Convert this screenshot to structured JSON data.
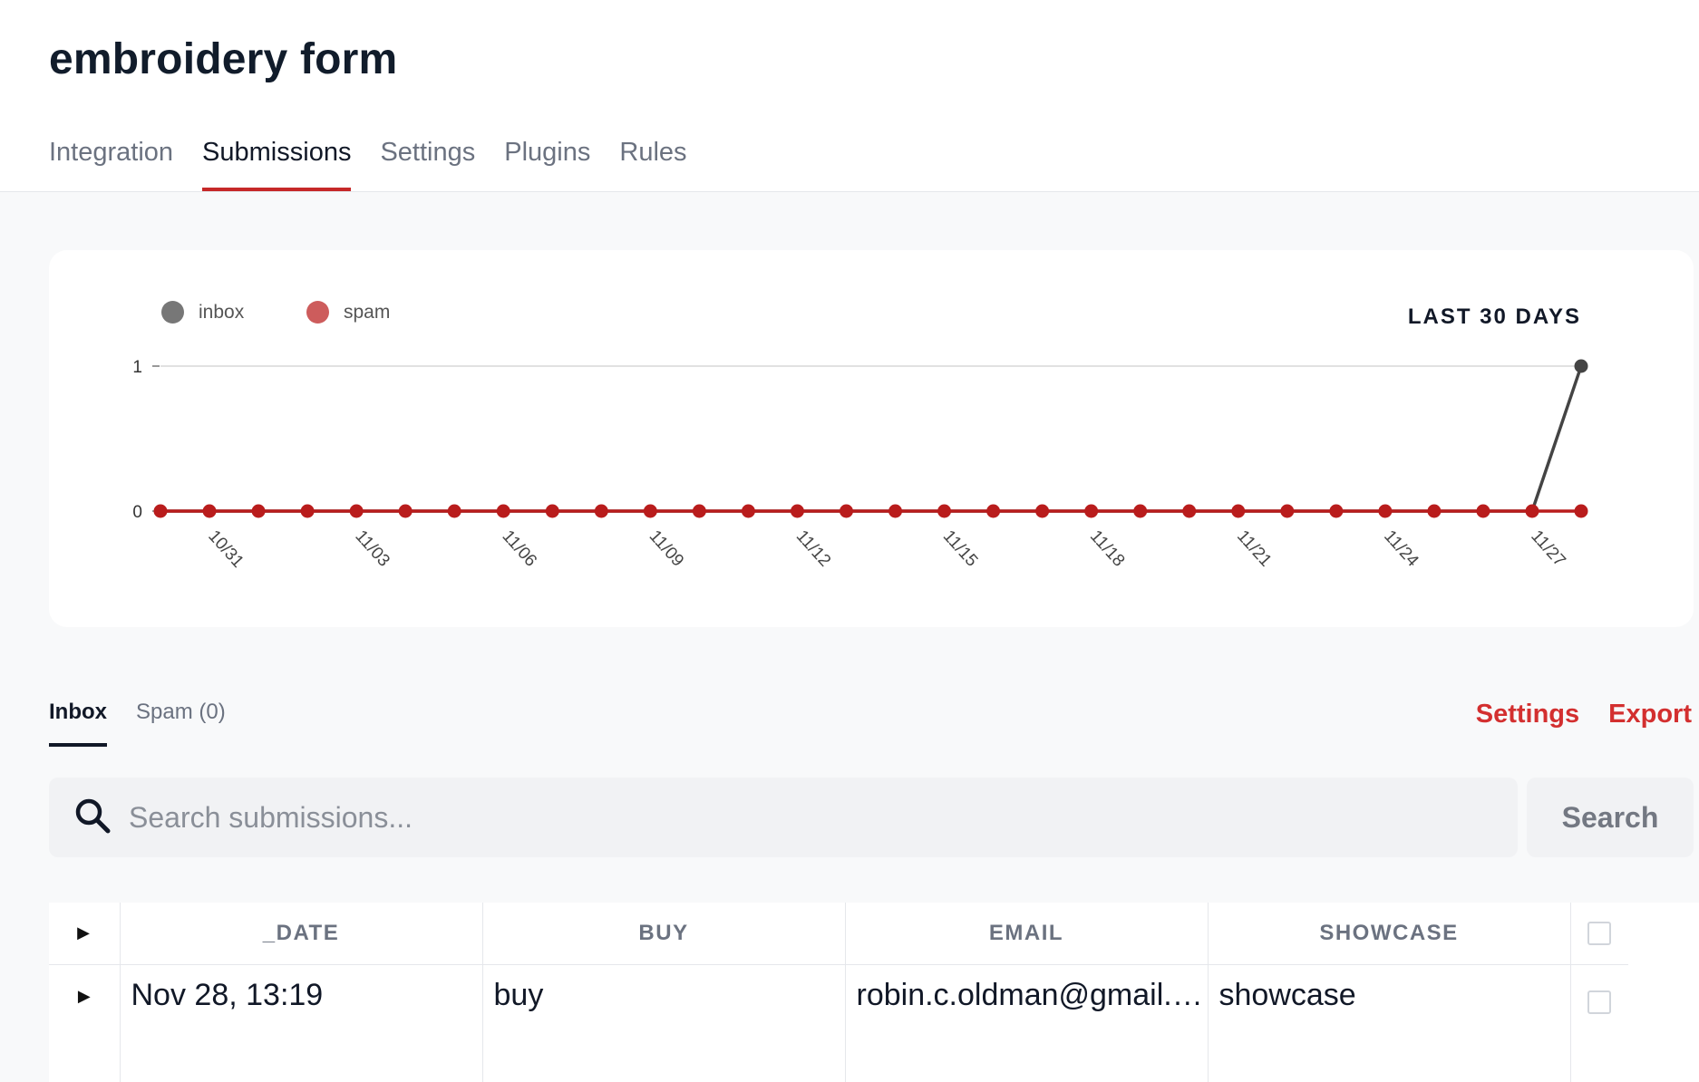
{
  "page": {
    "title": "embroidery form"
  },
  "tabs": [
    {
      "label": "Integration",
      "active": false
    },
    {
      "label": "Submissions",
      "active": true
    },
    {
      "label": "Settings",
      "active": false
    },
    {
      "label": "Plugins",
      "active": false
    },
    {
      "label": "Rules",
      "active": false
    }
  ],
  "chart": {
    "range_label": "LAST 30 DAYS",
    "legend": [
      {
        "name": "inbox",
        "color": "#777777"
      },
      {
        "name": "spam",
        "color": "#cd5c5c"
      }
    ]
  },
  "chart_data": {
    "type": "line",
    "title": "",
    "xlabel": "",
    "ylabel": "",
    "ylim": [
      0,
      1
    ],
    "yticks": [
      0,
      1
    ],
    "grid": true,
    "legend_position": "top-left",
    "x": [
      "10/30",
      "10/31",
      "11/01",
      "11/02",
      "11/03",
      "11/04",
      "11/05",
      "11/06",
      "11/07",
      "11/08",
      "11/09",
      "11/10",
      "11/11",
      "11/12",
      "11/13",
      "11/14",
      "11/15",
      "11/16",
      "11/17",
      "11/18",
      "11/19",
      "11/20",
      "11/21",
      "11/22",
      "11/23",
      "11/24",
      "11/25",
      "11/26",
      "11/27",
      "11/28"
    ],
    "xtick_labels": [
      "10/31",
      "11/03",
      "11/06",
      "11/09",
      "11/12",
      "11/15",
      "11/18",
      "11/21",
      "11/24",
      "11/27"
    ],
    "series": [
      {
        "name": "inbox",
        "color": "#444444",
        "values": [
          0,
          0,
          0,
          0,
          0,
          0,
          0,
          0,
          0,
          0,
          0,
          0,
          0,
          0,
          0,
          0,
          0,
          0,
          0,
          0,
          0,
          0,
          0,
          0,
          0,
          0,
          0,
          0,
          0,
          1
        ]
      },
      {
        "name": "spam",
        "color": "#b91c1c",
        "values": [
          0,
          0,
          0,
          0,
          0,
          0,
          0,
          0,
          0,
          0,
          0,
          0,
          0,
          0,
          0,
          0,
          0,
          0,
          0,
          0,
          0,
          0,
          0,
          0,
          0,
          0,
          0,
          0,
          0,
          0
        ]
      }
    ]
  },
  "submissions": {
    "tabs": [
      {
        "label": "Inbox",
        "active": true
      },
      {
        "label": "Spam (0)",
        "active": false
      }
    ],
    "actions": {
      "settings_label": "Settings",
      "export_label": "Export"
    },
    "search": {
      "placeholder": "Search submissions...",
      "value": "",
      "button_label": "Search"
    },
    "table": {
      "columns": [
        "_DATE",
        "BUY",
        "EMAIL",
        "SHOWCASE"
      ],
      "rows": [
        {
          "date": "Nov 28, 13:19",
          "buy": "buy",
          "email": "robin.c.oldman@gmail.…",
          "showcase": "showcase"
        }
      ]
    }
  },
  "icons": {
    "search": "search-icon",
    "expand": "play-triangle-icon"
  }
}
